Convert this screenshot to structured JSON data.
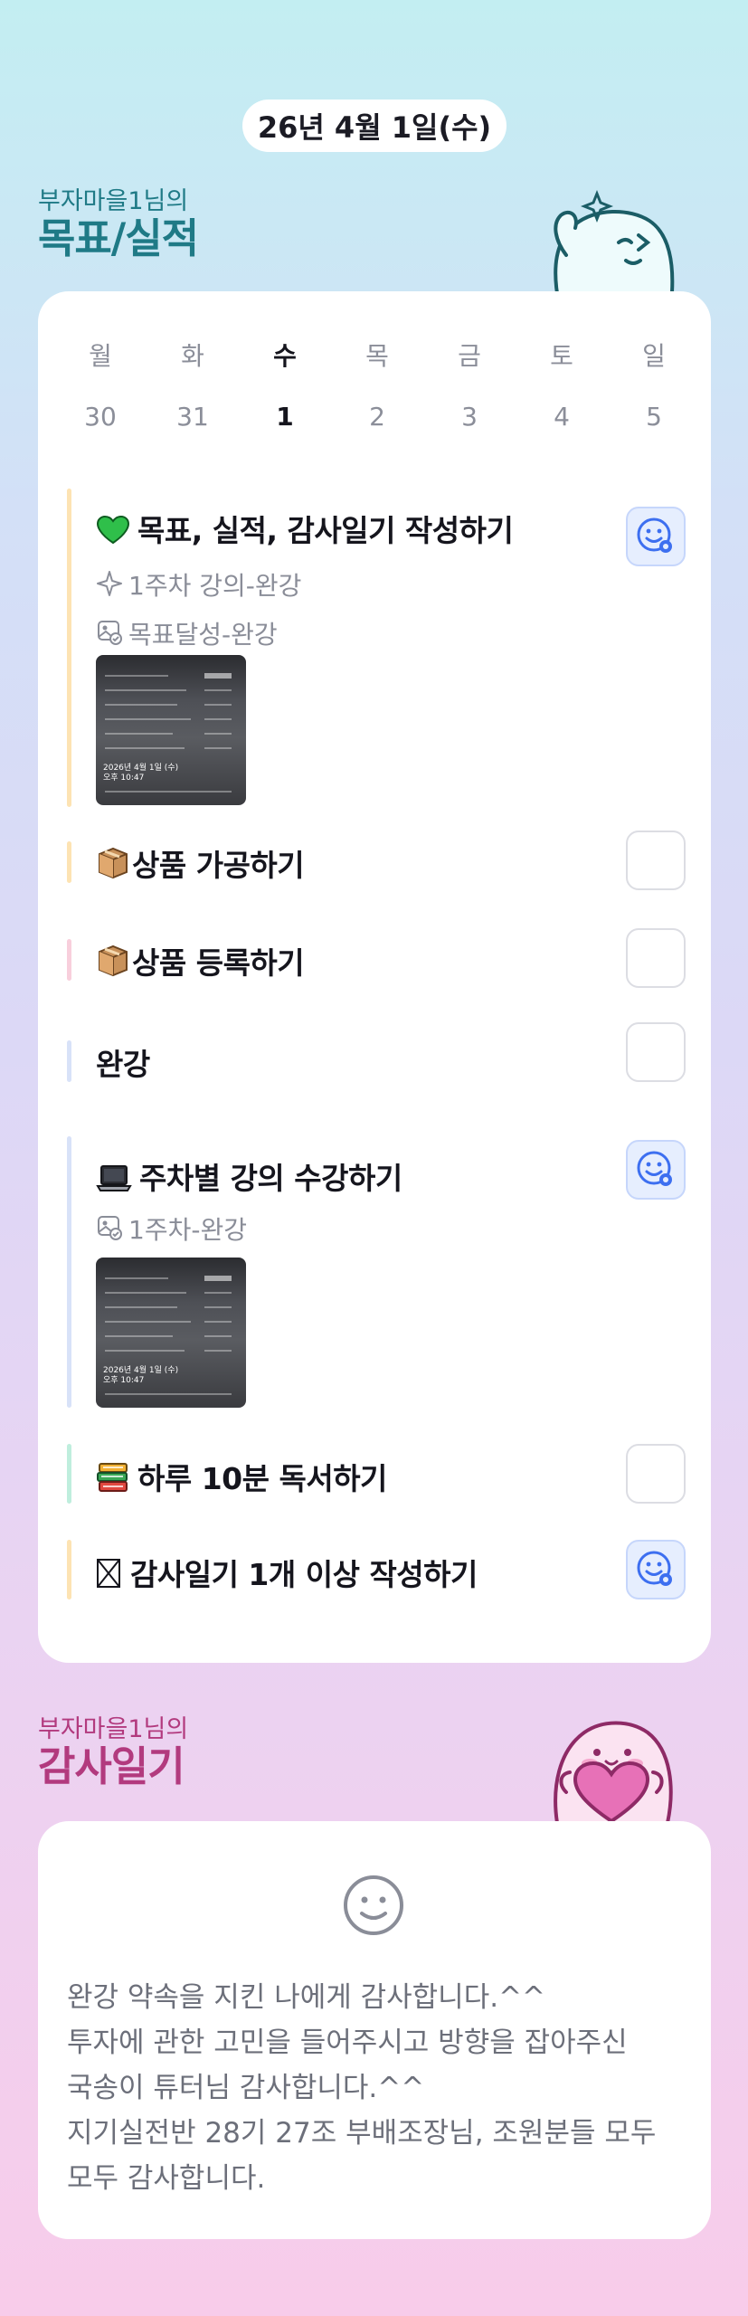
{
  "date": "26년 4월 1일(수)",
  "goal_section": {
    "sub": "부자마을1님의",
    "title": "목표/실적"
  },
  "week": {
    "days": [
      "월",
      "화",
      "수",
      "목",
      "금",
      "토",
      "일"
    ],
    "dates": [
      "30",
      "31",
      "1",
      "2",
      "3",
      "4",
      "5"
    ],
    "today_index": 2
  },
  "tasks": [
    {
      "title": "목표, 실적, 감사일기 작성하기",
      "icon": "green-heart-icon",
      "bar_color": "#fde3b3",
      "checked": true,
      "details": [
        {
          "icon": "sparkle-icon",
          "text": "1주차 강의-완강"
        },
        {
          "icon": "image-check-icon",
          "text": "목표달성-완강"
        }
      ],
      "has_photo": true
    },
    {
      "title": "상품 가공하기",
      "icon": "package-icon",
      "bar_color": "#fde3b3",
      "checked": false
    },
    {
      "title": "상품 등록하기",
      "icon": "package-icon",
      "bar_color": "#f8cfdc",
      "checked": false
    },
    {
      "title": "완강",
      "icon": "",
      "bar_color": "#d8e2f8",
      "checked": false
    },
    {
      "title": "주차별 강의 수강하기",
      "icon": "laptop-icon",
      "bar_color": "#d8e2f8",
      "checked": true,
      "details": [
        {
          "icon": "image-check-icon",
          "text": "1주차-완강"
        }
      ],
      "has_photo": true
    },
    {
      "title": "하루 10분 독서하기",
      "icon": "books-icon",
      "bar_color": "#bfeedd",
      "checked": false
    },
    {
      "title": "감사일기 1개 이상 작성하기",
      "icon": "ballot-box-icon",
      "bar_color": "#fde3b3",
      "checked": true
    }
  ],
  "photo_caption": [
    "2026년 4월 1일 (수)",
    "오후 10:47"
  ],
  "diary_section": {
    "sub": "부자마을1님의",
    "title": "감사일기"
  },
  "diary": {
    "lines": [
      "완강 약속을 지킨 나에게 감사합니다.^^",
      "투자에 관한 고민을 들어주시고 방향을 잡아주신",
      "국송이 튜터님 감사합니다.^^",
      "지기실전반 28기 27조 부배조장님, 조원분들 모두",
      "모두 감사합니다."
    ]
  },
  "colors": {
    "accent_goal": "#1f7a86",
    "accent_diary": "#b23a7e",
    "check_blue": "#3d6ff0"
  }
}
